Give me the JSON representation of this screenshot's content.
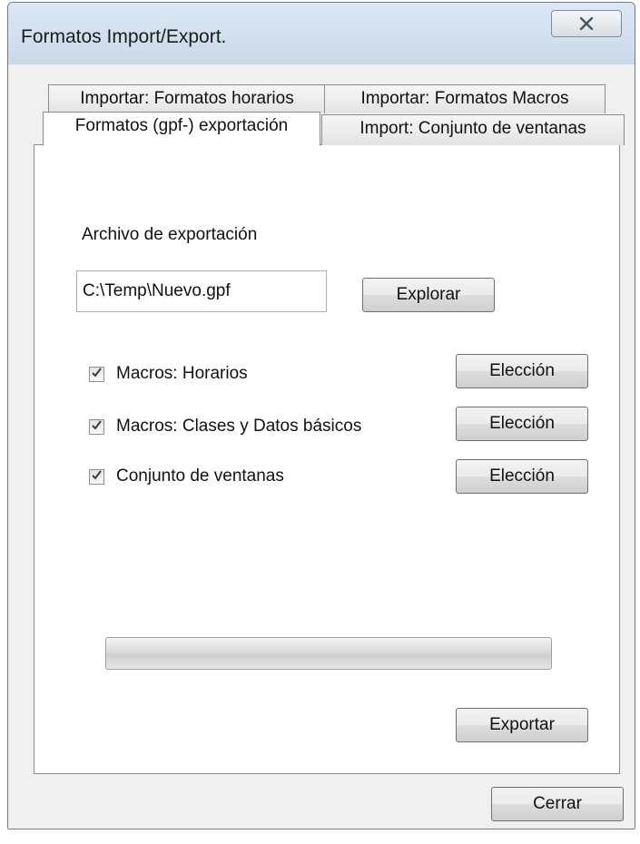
{
  "window": {
    "title": "Formatos Import/Export."
  },
  "tabs": [
    {
      "label": "Importar: Formatos horarios",
      "active": false
    },
    {
      "label": "Importar: Formatos Macros",
      "active": false
    },
    {
      "label": "Formatos (gpf-) exportación",
      "active": true
    },
    {
      "label": "Import: Conjunto de ventanas",
      "active": false
    }
  ],
  "export": {
    "file_label": "Archivo de exportación",
    "file_value": "C:\\Temp\\Nuevo.gpf",
    "browse_label": "Explorar",
    "options": [
      {
        "label": "Macros: Horarios",
        "checked": true,
        "button": "Elección"
      },
      {
        "label": "Macros: Clases y Datos básicos",
        "checked": true,
        "button": "Elección"
      },
      {
        "label": "Conjunto de ventanas",
        "checked": true,
        "button": "Elección"
      }
    ],
    "progress": 0,
    "export_label": "Exportar"
  },
  "footer": {
    "close_label": "Cerrar"
  }
}
